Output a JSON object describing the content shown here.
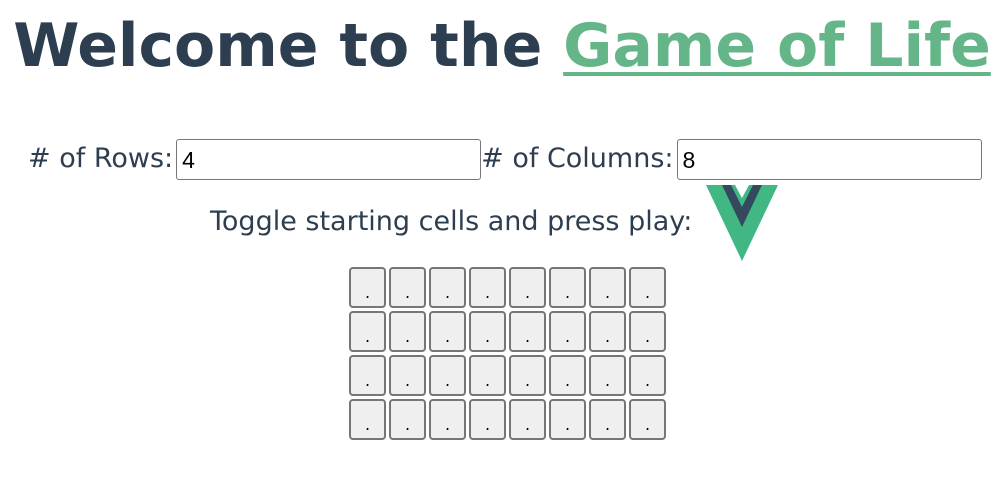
{
  "header": {
    "title_prefix": "Welcome to the ",
    "title_link": "Game of Life"
  },
  "controls": {
    "rows_label": "# of Rows:",
    "rows_value": "4",
    "cols_label": "# of Columns:",
    "cols_value": "8"
  },
  "prompt": {
    "text": "Toggle starting cells and press play:",
    "play_icon": "vue-logo-icon"
  },
  "grid": {
    "rows": 4,
    "columns": 8,
    "cells": [
      [
        ".",
        ".",
        ".",
        ".",
        ".",
        ".",
        ".",
        "."
      ],
      [
        ".",
        ".",
        ".",
        ".",
        ".",
        ".",
        ".",
        "."
      ],
      [
        ".",
        ".",
        ".",
        ".",
        ".",
        ".",
        ".",
        "."
      ],
      [
        ".",
        ".",
        ".",
        ".",
        ".",
        ".",
        ".",
        "."
      ]
    ]
  },
  "colors": {
    "text": "#2c3e50",
    "accent": "#64b587",
    "logo_dark": "#35495e",
    "logo_green": "#41b883"
  }
}
